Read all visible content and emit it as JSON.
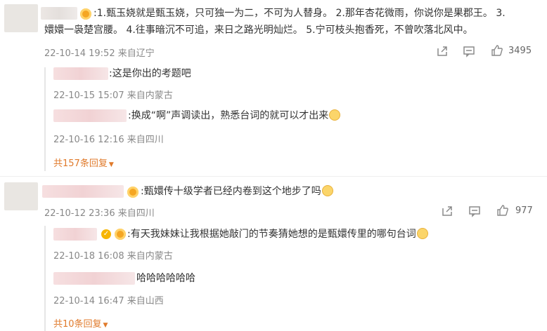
{
  "comments": [
    {
      "text_line1": ":1.甄玉娆就是甄玉娆，只可独一为二，不可为人替身。 2.那年杏花微雨，你说你是果郡王。 3.",
      "text_line2": "嬛嬛一袅楚宫腰。 4.往事暗沉不可追，来日之路光明灿烂。 5.宁可枝头抱香死，不曾吹落北风中。",
      "date": "22-10-14 19:52",
      "location": "来自辽宁",
      "likes": "3495",
      "replies": [
        {
          "text": ":这是你出的考题吧",
          "date": "22-10-15 15:07",
          "location": "来自内蒙古"
        },
        {
          "text": ":换成“啊”声调读出，熟悉台词的就可以才出来",
          "date": "22-10-16 12:16",
          "location": "来自四川"
        }
      ],
      "more_replies": "共157条回复"
    },
    {
      "text": ":甄嬛传十级学者已经内卷到这个地步了吗",
      "date": "22-10-12 23:36",
      "location": "来自四川",
      "likes": "977",
      "replies": [
        {
          "text": ":有天我妹妹让我根据她敲门的节奏猜她想的是甄嬛传里的哪句台词",
          "date": "22-10-18 16:08",
          "location": "来自内蒙古"
        },
        {
          "text": "哈哈哈哈哈哈",
          "date": "22-10-14 16:47",
          "location": "来自山西"
        }
      ],
      "more_replies": "共10条回复"
    }
  ],
  "icons": {
    "share": "share-icon",
    "comment": "comment-icon",
    "like": "thumbs-up-icon",
    "badge": "fan-badge-icon",
    "verified": "verified-badge-icon",
    "emoji": "emoji-icon",
    "caret": "caret-down-icon"
  },
  "colors": {
    "link_orange": "#e07a2b",
    "meta_grey": "#888888"
  }
}
